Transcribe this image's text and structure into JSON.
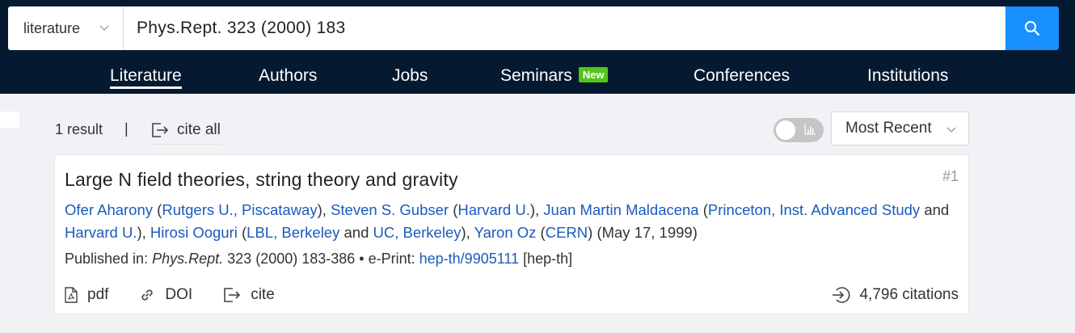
{
  "search": {
    "scope": "literature",
    "query": "Phys.Rept. 323 (2000) 183"
  },
  "nav": {
    "items": [
      {
        "label": "Literature",
        "active": true
      },
      {
        "label": "Authors"
      },
      {
        "label": "Jobs"
      },
      {
        "label": "Seminars",
        "badge": "New"
      },
      {
        "label": "Conferences"
      },
      {
        "label": "Institutions"
      }
    ]
  },
  "results": {
    "count": "1 result",
    "separator": "|",
    "cite_all": "cite all",
    "sort": "Most Recent"
  },
  "record": {
    "title": "Large N field theories, string theory and gravity",
    "index": "#1",
    "authors": [
      {
        "name": "Ofer Aharony",
        "affiliations": [
          "Rutgers U., Piscataway"
        ]
      },
      {
        "name": "Steven S. Gubser",
        "affiliations": [
          "Harvard U."
        ]
      },
      {
        "name": "Juan Martin Maldacena",
        "affiliations": [
          "Princeton, Inst. Advanced Study",
          "Harvard U."
        ]
      },
      {
        "name": "Hirosi Ooguri",
        "affiliations": [
          "LBL, Berkeley",
          "UC, Berkeley"
        ]
      },
      {
        "name": "Yaron Oz",
        "affiliations": [
          "CERN"
        ]
      }
    ],
    "and_word": "and",
    "date": "(May 17, 1999)",
    "published_label": "Published in:",
    "journal": "Phys.Rept.",
    "journal_rest": "323 (2000) 183-386",
    "eprint_label": "• e-Print:",
    "eprint": "hep-th/9905111",
    "eprint_category": "[hep-th]",
    "actions": {
      "pdf": "pdf",
      "doi": "DOI",
      "cite": "cite"
    },
    "citations": "4,796 citations"
  },
  "colors": {
    "header_bg": "#051a30",
    "accent": "#1890ff",
    "link": "#1a5bbd",
    "badge_new": "#52c41a",
    "page_bg": "#f0f2f5"
  },
  "icons": {
    "scope_chevron": "chevron-down-icon",
    "search": "search-icon",
    "cite_all": "export-icon",
    "toggle": "bar-chart-icon",
    "pdf": "file-pdf-icon",
    "doi": "link-icon",
    "cite": "export-icon",
    "citations": "login-icon"
  }
}
